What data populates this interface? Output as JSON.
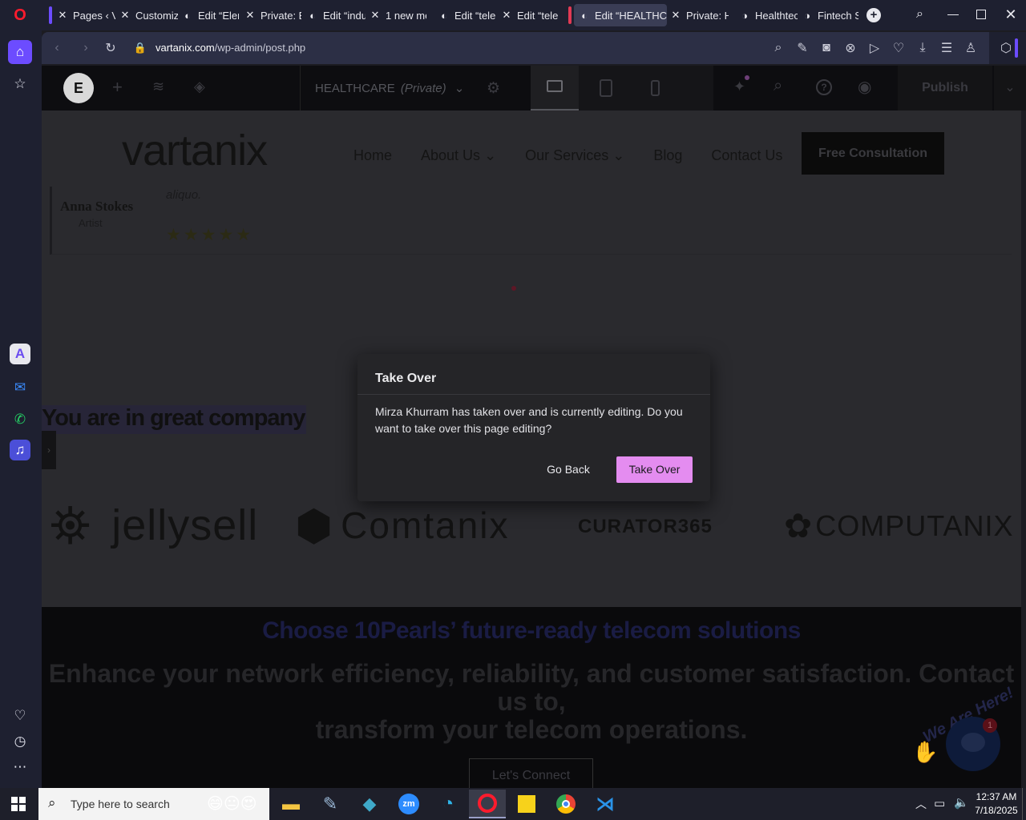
{
  "browser": {
    "tabs": [
      {
        "label": "Pages ‹ V",
        "icon": "x-logo-icon"
      },
      {
        "label": "Customiz",
        "icon": "x-logo-icon"
      },
      {
        "label": "Edit “Elen",
        "icon": "globe-icon"
      },
      {
        "label": "Private: E",
        "icon": "x-logo-icon"
      },
      {
        "label": "Edit “indu",
        "icon": "globe-icon"
      },
      {
        "label": "1 new me",
        "icon": "x-logo-icon"
      },
      {
        "label": "Edit “tele",
        "icon": "globe-icon"
      },
      {
        "label": "Edit “tele",
        "icon": "x-logo-icon"
      },
      {
        "label": "Edit “HEALTHCA",
        "icon": "globe-icon",
        "active": true
      },
      {
        "label": "Private: H",
        "icon": "x-logo-icon"
      },
      {
        "label": "Healthtec",
        "icon": "c-logo-icon"
      },
      {
        "label": "Fintech S",
        "icon": "c-logo-icon"
      }
    ],
    "url_domain": "vartanix.com",
    "url_path": "/wp-admin/post.php"
  },
  "editor": {
    "page_title": "HEALTHCARE",
    "page_status": "(Private)",
    "publish_label": "Publish"
  },
  "site": {
    "logo_text": "vartanix",
    "nav": [
      {
        "label": "Home"
      },
      {
        "label": "About Us"
      },
      {
        "label": "Our Services"
      },
      {
        "label": "Blog"
      },
      {
        "label": "Contact Us"
      }
    ],
    "cta_label": "Free Consultation",
    "testimonial": {
      "quote_fragment": "aliquo.",
      "name": "Anna Stokes",
      "role": "Artist",
      "stars": "★★★★★"
    },
    "company_heading": "You are in great company",
    "clients": [
      "jellysell",
      "Comtanix",
      "CURATOR365",
      "COMPUTANIX"
    ],
    "cta_section": {
      "heading": "Choose 10Pearls’ future-ready telecom solutions",
      "body_line1": "Enhance your network efficiency, reliability, and customer satisfaction. Contact",
      "body_line2": "us to,",
      "body_line3": "transform your telecom operations.",
      "button": "Let's Connect"
    },
    "chat_badge": "1",
    "chat_text": "We Are Here!"
  },
  "dialog": {
    "title": "Take Over",
    "message": "Mirza Khurram has taken over and is currently editing. Do you want to take over this page editing?",
    "go_back": "Go Back",
    "take_over": "Take Over",
    "accent": "#e48cf0"
  },
  "taskbar": {
    "search_placeholder": "Type here to search",
    "time": "12:37 AM",
    "date": "7/18/2025"
  }
}
